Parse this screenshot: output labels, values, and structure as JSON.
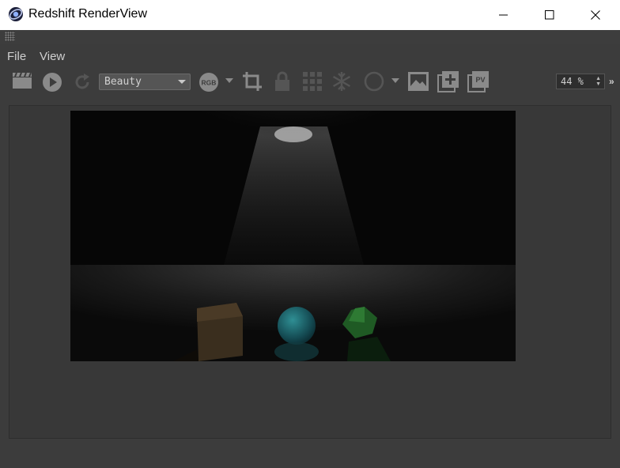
{
  "window": {
    "title": "Redshift RenderView",
    "minimize_icon": "minimize-icon",
    "maximize_icon": "maximize-icon",
    "close_icon": "close-icon"
  },
  "menu": {
    "items": [
      {
        "label": "File"
      },
      {
        "label": "View"
      }
    ]
  },
  "toolbar": {
    "icons": [
      "clapperboard-icon",
      "play-icon",
      "refresh-icon",
      "rgb-channel-icon",
      "dropdown-arrow-icon",
      "crop-icon",
      "lock-icon",
      "grid-icon",
      "snowflake-icon",
      "circle-icon",
      "dropdown-arrow-icon",
      "image-icon",
      "add-snapshot-icon",
      "pv-icon"
    ],
    "aov_select": {
      "value": "Beauty"
    },
    "rgb_label": "RGB",
    "pv_label": "PV",
    "zoom": {
      "value": "44 %"
    },
    "more_label": "»"
  },
  "colors": {
    "window_bg": "#3c3c3c",
    "viewport_bg": "#383838",
    "titlebar_bg": "#ffffff",
    "icon_gray": "#8a8a8a",
    "text_light": "#cfcfcf"
  }
}
